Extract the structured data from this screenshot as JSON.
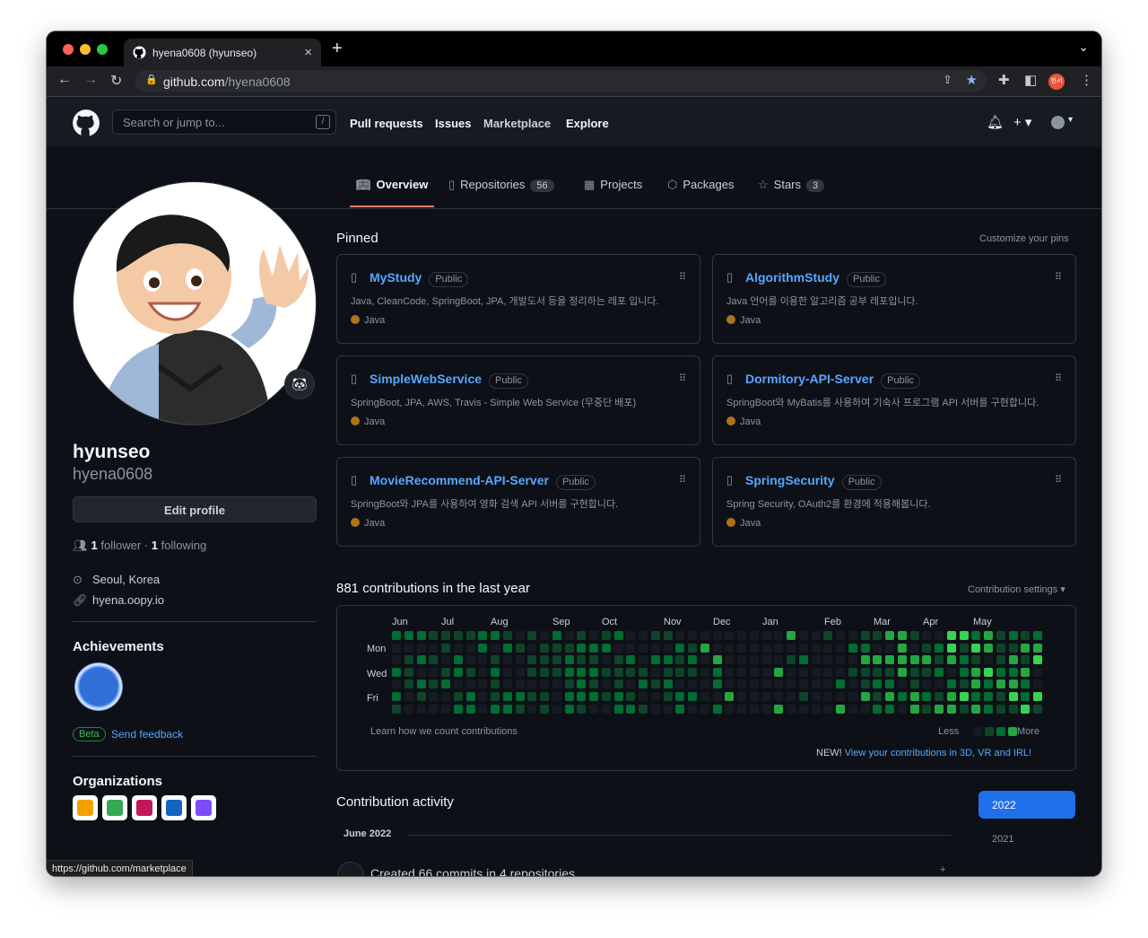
{
  "browser": {
    "tab_title": "hyena0608 (hyunseo)",
    "close_glyph": "×",
    "new_tab_glyph": "+",
    "url_host": "github.com",
    "url_path": "/hyena0608",
    "profile_chip": "현서",
    "status_url": "https://github.com/marketplace",
    "traffic_colors": [
      "#ff5f57",
      "#febc2e",
      "#28c840"
    ]
  },
  "header": {
    "search_placeholder": "Search or jump to...",
    "search_key": "/",
    "nav": [
      "Pull requests",
      "Issues",
      "Marketplace",
      "Explore"
    ]
  },
  "tabs": [
    {
      "label": "Overview",
      "icon": "book-icon"
    },
    {
      "label": "Repositories",
      "count": "56",
      "icon": "repo-icon"
    },
    {
      "label": "Projects",
      "icon": "table-icon"
    },
    {
      "label": "Packages",
      "icon": "package-icon"
    },
    {
      "label": "Stars",
      "count": "3",
      "icon": "star-icon"
    }
  ],
  "profile": {
    "name": "hyunseo",
    "login": "hyena0608",
    "edit_label": "Edit profile",
    "followers_count": "1",
    "followers_label": "follower",
    "separator": "·",
    "following_count": "1",
    "following_label": "following",
    "location": "Seoul, Korea",
    "website": "hyena.oopy.io",
    "achievements_title": "Achievements",
    "beta_label": "Beta",
    "feedback_label": "Send feedback",
    "orgs_title": "Organizations",
    "org_colors": [
      "#f4a100",
      "#34a853",
      "#c2185b",
      "#1565c0",
      "#7c4dff"
    ]
  },
  "pinned": {
    "title": "Pinned",
    "customize": "Customize your pins",
    "public_label": "Public",
    "repos": [
      {
        "name": "MyStudy",
        "desc": "Java, CleanCode, SpringBoot, JPA, 개발도서 등을 정리하는 레포 입니다.",
        "lang": "Java"
      },
      {
        "name": "AlgorithmStudy",
        "desc": "Java 언어를 이용한 알고리즘 공부 레포입니다.",
        "lang": "Java"
      },
      {
        "name": "SimpleWebService",
        "desc": "SpringBoot, JPA, AWS, Travis - Simple Web Service (무중단 배포)",
        "lang": "Java"
      },
      {
        "name": "Dormitory-API-Server",
        "desc": "SpringBoot와 MyBatis를 사용하여 기숙사 프로그램 API 서버를 구현합니다.",
        "lang": "Java"
      },
      {
        "name": "MovieRecommend-API-Server",
        "desc": "SpringBoot와 JPA를 사용하여 영화 검색 API 서버를 구현합니다.",
        "lang": "Java"
      },
      {
        "name": "SpringSecurity",
        "desc": "Spring Security, OAuth2를 환경에 적용해봅니다.",
        "lang": "Java"
      }
    ],
    "lang_color": "#b07219"
  },
  "contributions": {
    "title": "881 contributions in the last year",
    "settings": "Contribution settings ▾",
    "months": [
      "Jun",
      "Jul",
      "Aug",
      "Sep",
      "Oct",
      "Nov",
      "Dec",
      "Jan",
      "Feb",
      "Mar",
      "Apr",
      "May"
    ],
    "days": [
      "Mon",
      "Wed",
      "Fri"
    ],
    "learn": "Learn how we count contributions",
    "less": "Less",
    "more": "More",
    "new_prefix": "NEW!",
    "new_link": "View your contributions in 3D, VR and IRL!",
    "levels": [
      "#161b22",
      "#0e4429",
      "#006d32",
      "#26a641",
      "#39d353"
    ],
    "weeks": 53
  },
  "activity": {
    "title": "Contribution activity",
    "years": [
      "2022",
      "2021"
    ],
    "month_header": "June 2022",
    "item": "Created 66 commits in 4 repositories",
    "expand_glyph": "+"
  }
}
